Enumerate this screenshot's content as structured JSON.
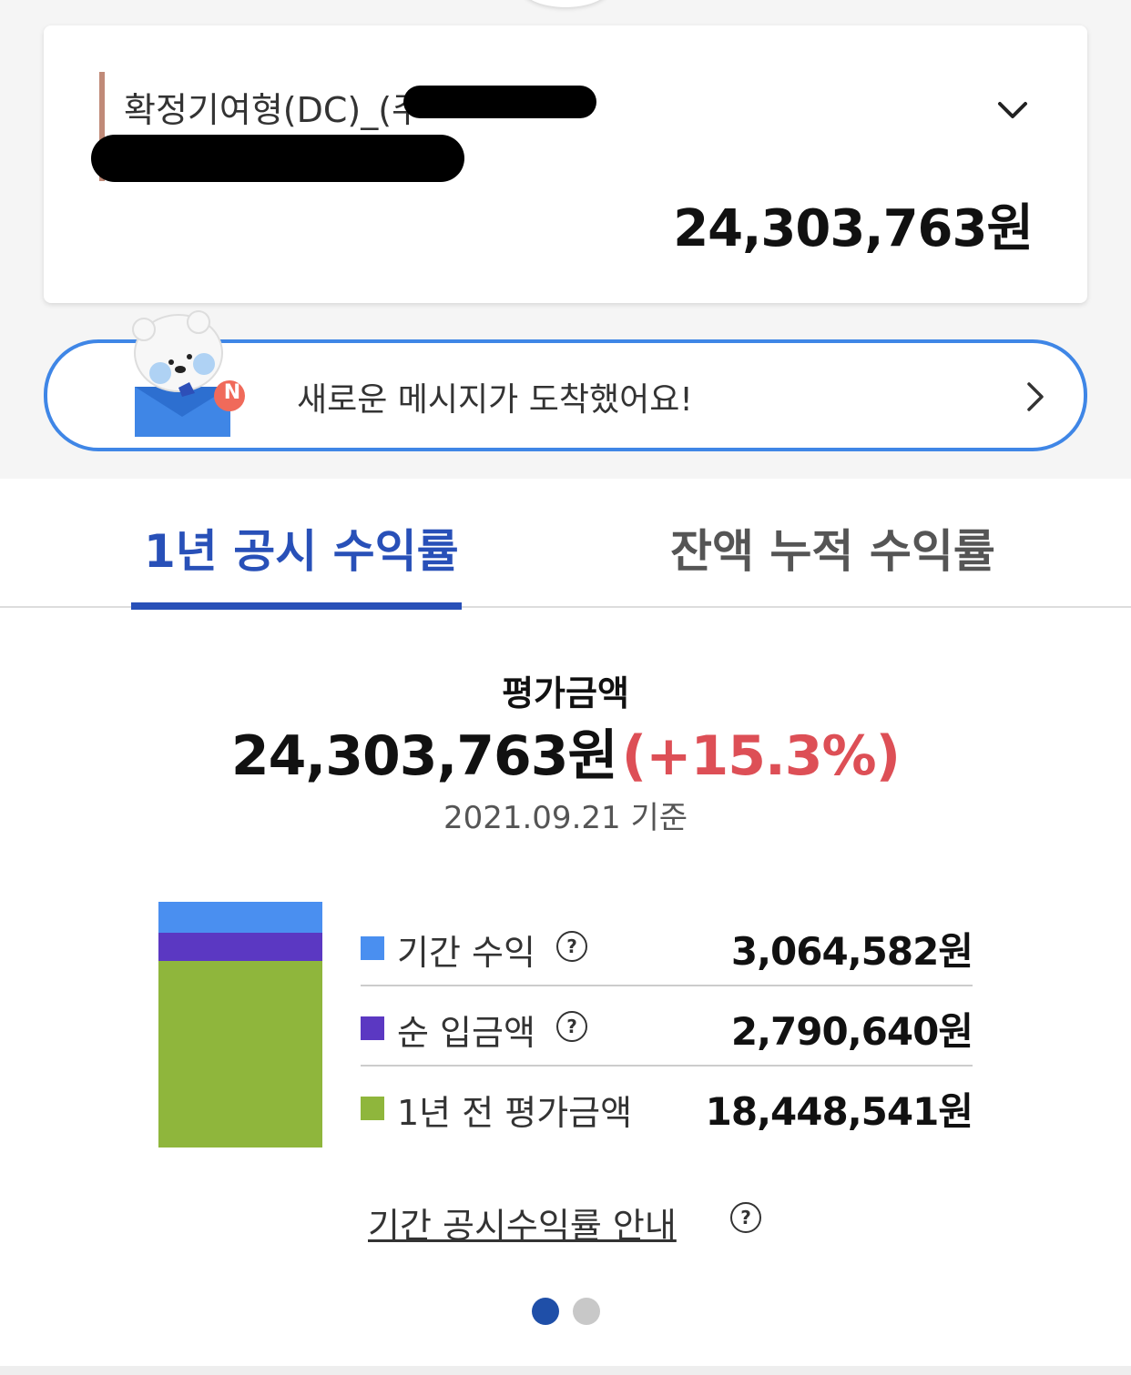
{
  "account": {
    "name": "확정기여형(DC)_(주",
    "balance": "24,303,763원"
  },
  "message_banner": {
    "text": "새로운 메시지가 도착했어요!",
    "badge": "N"
  },
  "tabs": [
    {
      "label": "1년 공시 수익률",
      "active": true
    },
    {
      "label": "잔액 누적 수익률",
      "active": false
    }
  ],
  "evaluation": {
    "title": "평가금액",
    "amount": "24,303,763원",
    "rate": "(+15.3%)",
    "date": "2021.09.21 기준"
  },
  "breakdown": {
    "items": [
      {
        "label": "기간 수익",
        "value": "3,064,582원",
        "color": "#4a8ff0",
        "amount": 3064582,
        "has_help": true
      },
      {
        "label": "순 입금액",
        "value": "2,790,640원",
        "color": "#5b38c2",
        "amount": 2790640,
        "has_help": true
      },
      {
        "label": "1년 전 평가금액",
        "value": "18,448,541원",
        "color": "#8fb63c",
        "amount": 18448541,
        "has_help": false
      }
    ]
  },
  "guide_link": "기간 공시수익률 안내",
  "help_glyph": "?",
  "pager": {
    "total": 2,
    "current": 1,
    "active_color": "#1f4fa8",
    "inactive_color": "#c8c8c8"
  }
}
